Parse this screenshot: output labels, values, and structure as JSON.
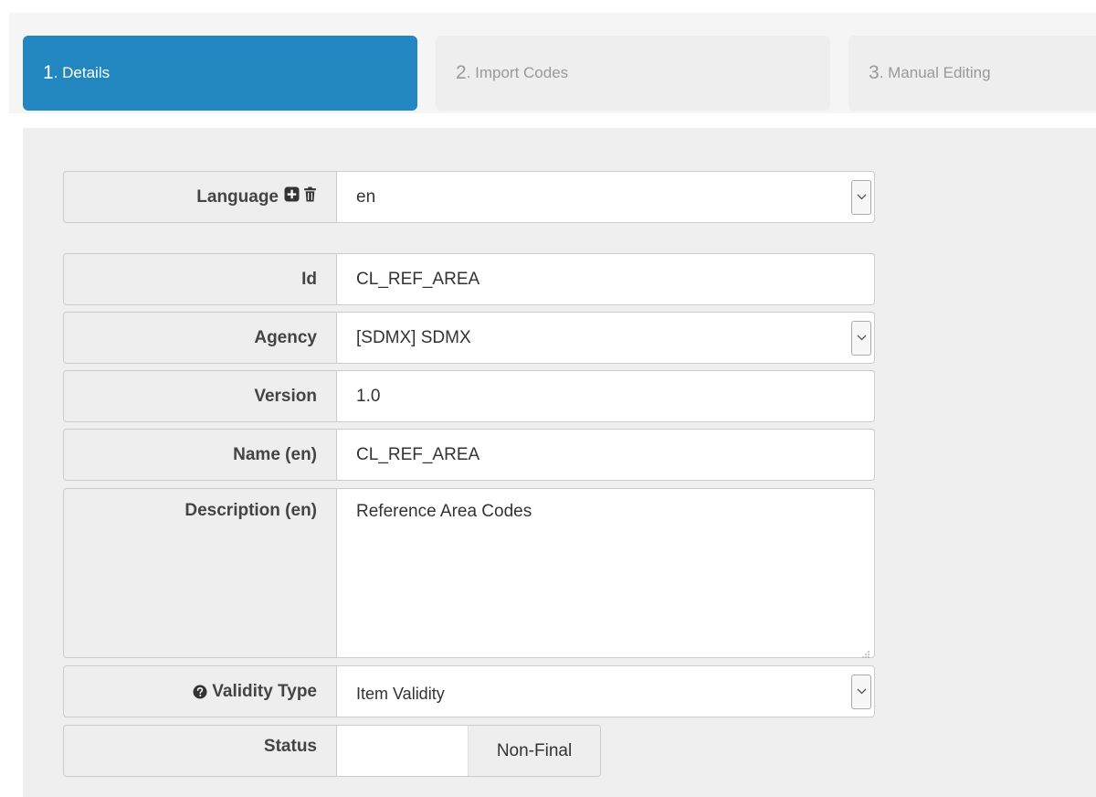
{
  "wizard": {
    "steps": [
      {
        "num": "1",
        "label": ". Details",
        "active": true
      },
      {
        "num": "2",
        "label": ". Import Codes",
        "active": false
      },
      {
        "num": "3",
        "label": ". Manual Editing",
        "active": false
      }
    ]
  },
  "form": {
    "language": {
      "label": "Language",
      "value": "en",
      "add_icon": "plus-square-icon",
      "delete_icon": "trash-icon"
    },
    "id": {
      "label": "Id",
      "value": "CL_REF_AREA"
    },
    "agency": {
      "label": "Agency",
      "value": "[SDMX] SDMX"
    },
    "version": {
      "label": "Version",
      "value": "1.0"
    },
    "name": {
      "label": "Name (en)",
      "value": "CL_REF_AREA"
    },
    "description": {
      "label": "Description (en)",
      "value": "Reference Area Codes"
    },
    "validity_type": {
      "label": "Validity Type",
      "value": "Item Validity",
      "help_icon": "question-circle-icon"
    },
    "status": {
      "label": "Status",
      "value": "Non-Final"
    }
  },
  "colors": {
    "accent": "#2287c1",
    "panel_bg": "#efefef",
    "label_bg": "#eeeeee"
  }
}
